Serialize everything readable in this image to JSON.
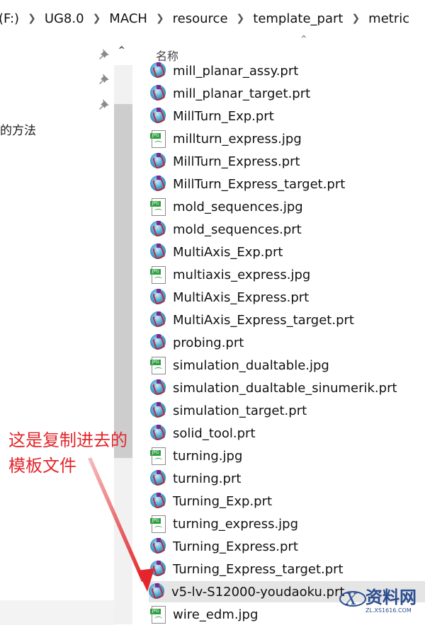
{
  "address_bar": {
    "crumbs": [
      "(F:)",
      "UG8.0",
      "MACH",
      "resource",
      "template_part",
      "metric"
    ],
    "separator_icon": "chevron-right-icon"
  },
  "nav": {
    "text": "的方法",
    "pin_icon": "pin-icon"
  },
  "list": {
    "column_header": "名称",
    "files": [
      {
        "name": "mill_planar_assy.prt",
        "type": "prt"
      },
      {
        "name": "mill_planar_target.prt",
        "type": "prt"
      },
      {
        "name": "MillTurn_Exp.prt",
        "type": "prt"
      },
      {
        "name": "millturn_express.jpg",
        "type": "jpg"
      },
      {
        "name": "MillTurn_Express.prt",
        "type": "prt"
      },
      {
        "name": "MillTurn_Express_target.prt",
        "type": "prt"
      },
      {
        "name": "mold_sequences.jpg",
        "type": "jpg"
      },
      {
        "name": "mold_sequences.prt",
        "type": "prt"
      },
      {
        "name": "MultiAxis_Exp.prt",
        "type": "prt"
      },
      {
        "name": "multiaxis_express.jpg",
        "type": "jpg"
      },
      {
        "name": "MultiAxis_Express.prt",
        "type": "prt"
      },
      {
        "name": "MultiAxis_Express_target.prt",
        "type": "prt"
      },
      {
        "name": "probing.prt",
        "type": "prt"
      },
      {
        "name": "simulation_dualtable.jpg",
        "type": "jpg"
      },
      {
        "name": "simulation_dualtable_sinumerik.prt",
        "type": "prt"
      },
      {
        "name": "simulation_target.prt",
        "type": "prt"
      },
      {
        "name": "solid_tool.prt",
        "type": "prt"
      },
      {
        "name": "turning.jpg",
        "type": "jpg"
      },
      {
        "name": "turning.prt",
        "type": "prt"
      },
      {
        "name": "Turning_Exp.prt",
        "type": "prt"
      },
      {
        "name": "turning_express.jpg",
        "type": "jpg"
      },
      {
        "name": "Turning_Express.prt",
        "type": "prt"
      },
      {
        "name": "Turning_Express_target.prt",
        "type": "prt"
      },
      {
        "name": "v5-lv-S12000-youdaoku.prt",
        "type": "prt",
        "selected": true
      },
      {
        "name": "wire_edm.jpg",
        "type": "jpg"
      }
    ]
  },
  "annotation": {
    "line1": "这是复制进去的",
    "line2": "模板文件",
    "color": "#e3262b"
  },
  "watermark": {
    "text": "资料网",
    "url": "ZL.XS1616.COM"
  }
}
